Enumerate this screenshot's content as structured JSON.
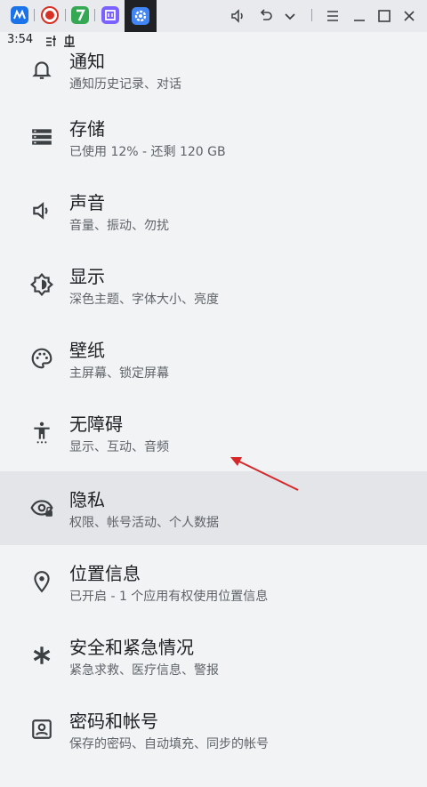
{
  "status_bar": {
    "time": "3:54",
    "icons": [
      "weather-icon",
      "bug-icon"
    ]
  },
  "settings": {
    "items": [
      {
        "title": "通知",
        "subtitle": "通知历史记录、对话",
        "icon": "bell-icon"
      },
      {
        "title": "存储",
        "subtitle": "已使用 12% - 还剩 120 GB",
        "icon": "storage-icon"
      },
      {
        "title": "声音",
        "subtitle": "音量、振动、勿扰",
        "icon": "volume-icon"
      },
      {
        "title": "显示",
        "subtitle": "深色主题、字体大小、亮度",
        "icon": "brightness-icon"
      },
      {
        "title": "壁纸",
        "subtitle": "主屏幕、锁定屏幕",
        "icon": "palette-icon"
      },
      {
        "title": "无障碍",
        "subtitle": "显示、互动、音频",
        "icon": "accessibility-icon"
      },
      {
        "title": "隐私",
        "subtitle": "权限、帐号活动、个人数据",
        "icon": "privacy-eye-icon"
      },
      {
        "title": "位置信息",
        "subtitle": "已开启 - 1 个应用有权使用位置信息",
        "icon": "location-pin-icon"
      },
      {
        "title": "安全和紧急情况",
        "subtitle": "紧急求救、医疗信息、警报",
        "icon": "asterisk-icon"
      },
      {
        "title": "密码和帐号",
        "subtitle": "保存的密码、自动填充、同步的帐号",
        "icon": "account-box-icon"
      }
    ]
  },
  "colors": {
    "accent_arrow": "#d62828",
    "highlight_row": "#e3e5e8",
    "background": "#f1f3f4"
  }
}
